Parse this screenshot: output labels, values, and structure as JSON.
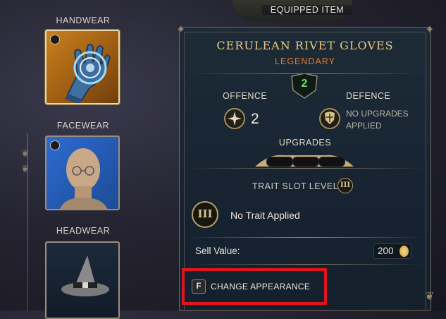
{
  "header": {
    "equipped_label": "EQUIPPED ITEM"
  },
  "gear_slots": [
    {
      "label": "HANDWEAR",
      "selected": true
    },
    {
      "label": "FACEWEAR",
      "selected": false
    },
    {
      "label": "HEADWEAR",
      "selected": false
    }
  ],
  "item": {
    "name": "CERULEAN RIVET GLOVES",
    "rarity": "LEGENDARY",
    "level": "2",
    "offence_label": "OFFENCE",
    "offence_value": "2",
    "defence_label": "DEFENCE",
    "defence_line1": "NO UPGRADES",
    "defence_line2": "APPLIED",
    "upgrades_label": "UPGRADES",
    "trait_slot_level_label": "TRAIT SLOT LEVEL",
    "trait_slot_level": "III",
    "trait_badge": "III",
    "trait_text": "No Trait Applied",
    "sell_label": "Sell Value:",
    "sell_value": "200"
  },
  "actions": {
    "change_key": "F",
    "change_label": "CHANGE APPEARANCE"
  },
  "colors": {
    "rarity": "#e07a30",
    "title": "#e7c980",
    "level": "#6fe06a",
    "highlight": "#e0151b"
  },
  "icons": {
    "offence": "offence-star-icon",
    "defence": "defence-shield-icon",
    "coin": "coin-icon"
  }
}
